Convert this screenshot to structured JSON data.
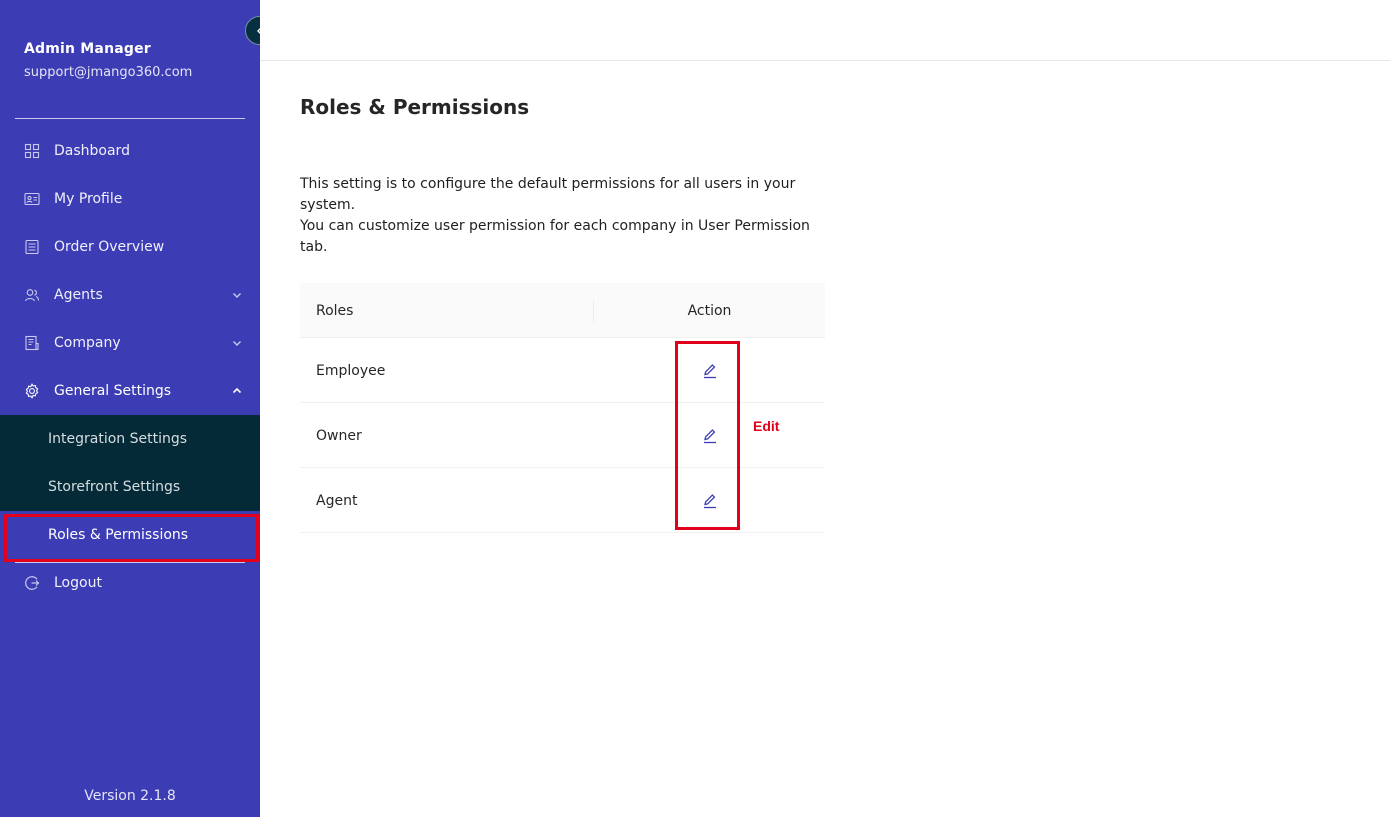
{
  "sidebar": {
    "user_name": "Admin Manager",
    "user_email": "support@jmango360.com",
    "items": [
      {
        "label": "Dashboard",
        "icon": "dashboard-icon"
      },
      {
        "label": "My Profile",
        "icon": "profile-card-icon"
      },
      {
        "label": "Order Overview",
        "icon": "order-list-icon"
      },
      {
        "label": "Agents",
        "icon": "agents-icon",
        "expandable": true
      },
      {
        "label": "Company",
        "icon": "company-icon",
        "expandable": true
      },
      {
        "label": "General Settings",
        "icon": "gear-icon",
        "expanded": true
      }
    ],
    "submenu": [
      {
        "label": "Integration Settings"
      },
      {
        "label": "Storefront Settings"
      },
      {
        "label": "Roles & Permissions",
        "selected": true
      }
    ],
    "logout_label": "Logout",
    "version": "Version 2.1.8",
    "colors": {
      "background": "#3c3cb4",
      "submenu_background": "#042a38"
    }
  },
  "main": {
    "title": "Roles & Permissions",
    "description_line1": "This setting is to configure the default permissions for all users in your system.",
    "description_line2": "You can customize user permission for each company in User Permission tab.",
    "table": {
      "columns": [
        "Roles",
        "Action"
      ],
      "rows": [
        {
          "role": "Employee",
          "action_icon": "edit-icon"
        },
        {
          "role": "Owner",
          "action_icon": "edit-icon"
        },
        {
          "role": "Agent",
          "action_icon": "edit-icon"
        }
      ]
    }
  },
  "annotation": {
    "edit_label": "Edit",
    "color": "#e3001b"
  }
}
